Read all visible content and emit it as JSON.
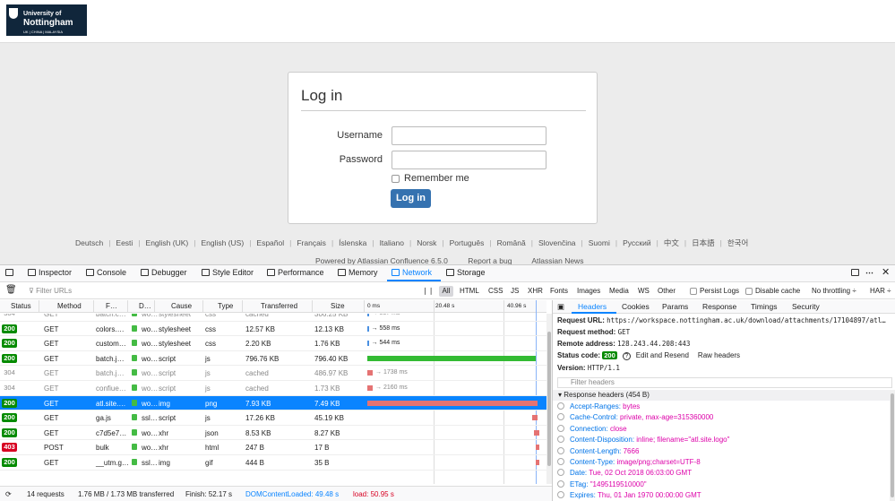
{
  "site": {
    "logo_line1": "University of",
    "logo_line2": "Nottingham",
    "logo_line3": "UK | CHINA | MALAYSIA"
  },
  "login": {
    "title": "Log in",
    "username_label": "Username",
    "password_label": "Password",
    "remember_label": "Remember me",
    "button_label": "Log in"
  },
  "languages": [
    "Deutsch",
    "Eesti",
    "English (UK)",
    "English (US)",
    "Español",
    "Français",
    "Íslenska",
    "Italiano",
    "Norsk",
    "Português",
    "Română",
    "Slovenčina",
    "Suomi",
    "Русский",
    "中文",
    "日本語",
    "한국어"
  ],
  "footer": {
    "powered": "Powered by Atlassian Confluence 6.5.0",
    "report": "Report a bug",
    "news": "Atlassian News"
  },
  "devtools": {
    "tabs": [
      "Inspector",
      "Console",
      "Debugger",
      "Style Editor",
      "Performance",
      "Memory",
      "Network",
      "Storage"
    ],
    "active_tab": "Network",
    "filter_placeholder": "Filter URLs",
    "type_filters": [
      "All",
      "HTML",
      "CSS",
      "JS",
      "XHR",
      "Fonts",
      "Images",
      "Media",
      "WS",
      "Other"
    ],
    "persist_logs": "Persist Logs",
    "disable_cache": "Disable cache",
    "throttling": "No throttling ÷",
    "har": "HAR ÷",
    "columns": [
      "Status",
      "Method",
      "F…",
      "D…",
      "Cause",
      "Type",
      "Transferred",
      "Size"
    ],
    "timeline_ticks": [
      "0 ms",
      "20.48 s",
      "40.96 s"
    ],
    "rows": [
      {
        "status": "304",
        "method": "GET",
        "file": "batch.c…",
        "domain": "wo…",
        "cause": "stylesheet",
        "type": "css",
        "transferred": "cached",
        "size": "306.25 KB",
        "timing": "→ 537 ms",
        "color": "#4a90e2",
        "start": 0,
        "len": 1.5
      },
      {
        "status": "200",
        "method": "GET",
        "file": "colors.…",
        "domain": "wo…",
        "cause": "stylesheet",
        "type": "css",
        "transferred": "12.57 KB",
        "size": "12.13 KB",
        "timing": "→ 558 ms",
        "color": "#4a90e2",
        "start": 0,
        "len": 1.5
      },
      {
        "status": "200",
        "method": "GET",
        "file": "custom…",
        "domain": "wo…",
        "cause": "stylesheet",
        "type": "css",
        "transferred": "2.20 KB",
        "size": "1.76 KB",
        "timing": "→ 544 ms",
        "color": "#4a90e2",
        "start": 0,
        "len": 1.5
      },
      {
        "status": "200",
        "method": "GET",
        "file": "batch.j…",
        "domain": "wo…",
        "cause": "script",
        "type": "js",
        "transferred": "796.76 KB",
        "size": "796.40 KB",
        "timing": "",
        "color": "#33bb33",
        "start": 0,
        "len": 188
      },
      {
        "status": "304",
        "method": "GET",
        "file": "batch.j…",
        "domain": "wo…",
        "cause": "script",
        "type": "js",
        "transferred": "cached",
        "size": "486.97 KB",
        "timing": "→ 1738 ms",
        "color": "#e57373",
        "start": 0,
        "len": 6
      },
      {
        "status": "304",
        "method": "GET",
        "file": "confiue…",
        "domain": "wo…",
        "cause": "script",
        "type": "js",
        "transferred": "cached",
        "size": "1.73 KB",
        "timing": "→ 2160 ms",
        "color": "#e57373",
        "start": 0,
        "len": 6
      },
      {
        "status": "200",
        "method": "GET",
        "file": "atl.site.…",
        "domain": "wo…",
        "cause": "img",
        "type": "png",
        "transferred": "7.93 KB",
        "size": "7.49 KB",
        "timing": "",
        "color": "#e57373",
        "start": 0,
        "len": 190,
        "selected": true
      },
      {
        "status": "200",
        "method": "GET",
        "file": "ga.js",
        "domain": "ssl…",
        "cause": "script",
        "type": "js",
        "transferred": "17.26 KB",
        "size": "45.19 KB",
        "timing": "",
        "color": "#e57373",
        "start": 184,
        "len": 6
      },
      {
        "status": "200",
        "method": "GET",
        "file": "c7d5e7…",
        "domain": "wo…",
        "cause": "xhr",
        "type": "json",
        "transferred": "8.53 KB",
        "size": "8.27 KB",
        "timing": "",
        "color": "#e57373",
        "start": 186,
        "len": 6
      },
      {
        "status": "403",
        "method": "POST",
        "file": "bulk",
        "domain": "wo…",
        "cause": "xhr",
        "type": "html",
        "transferred": "247 B",
        "size": "17 B",
        "timing": "",
        "color": "#e57373",
        "start": 188,
        "len": 4
      },
      {
        "status": "200",
        "method": "GET",
        "file": "__utm.g…",
        "domain": "ssl…",
        "cause": "img",
        "type": "gif",
        "transferred": "444 B",
        "size": "35 B",
        "timing": "",
        "color": "#e57373",
        "start": 188,
        "len": 4
      }
    ],
    "status_bar": {
      "requests": "14 requests",
      "size": "1.76 MB / 1.73 MB transferred",
      "finish": "Finish: 52.17 s",
      "dom": "DOMContentLoaded: 49.48 s",
      "load": "load: 50.95 s"
    }
  },
  "panel": {
    "tabs": [
      "Headers",
      "Cookies",
      "Params",
      "Response",
      "Timings",
      "Security"
    ],
    "active_tab": "Headers",
    "request_url_label": "Request URL:",
    "request_url": "https://workspace.nottingham.ac.uk/download/attachments/17104897/atl…",
    "request_method_label": "Request method:",
    "request_method": "GET",
    "remote_address_label": "Remote address:",
    "remote_address": "128.243.44.208:443",
    "status_code_label": "Status code:",
    "status_code": "200",
    "edit_resend": "Edit and Resend",
    "raw_headers": "Raw headers",
    "version_label": "Version:",
    "version": "HTTP/1.1",
    "filter_headers": "Filter headers",
    "response_headers": "▾ Response headers (454 B)",
    "headers": [
      {
        "k": "Accept-Ranges:",
        "v": "bytes"
      },
      {
        "k": "Cache-Control:",
        "v": "private, max-age=315360000"
      },
      {
        "k": "Connection:",
        "v": "close"
      },
      {
        "k": "Content-Disposition:",
        "v": "inline; filename=\"atl.site.logo\""
      },
      {
        "k": "Content-Length:",
        "v": "7666"
      },
      {
        "k": "Content-Type:",
        "v": "image/png;charset=UTF-8"
      },
      {
        "k": "Date:",
        "v": "Tue, 02 Oct 2018 06:03:00 GMT"
      },
      {
        "k": "ETag:",
        "v": "\"1495119510000\""
      },
      {
        "k": "Expires:",
        "v": "Thu, 01 Jan 1970 00:00:00 GMT"
      }
    ]
  }
}
